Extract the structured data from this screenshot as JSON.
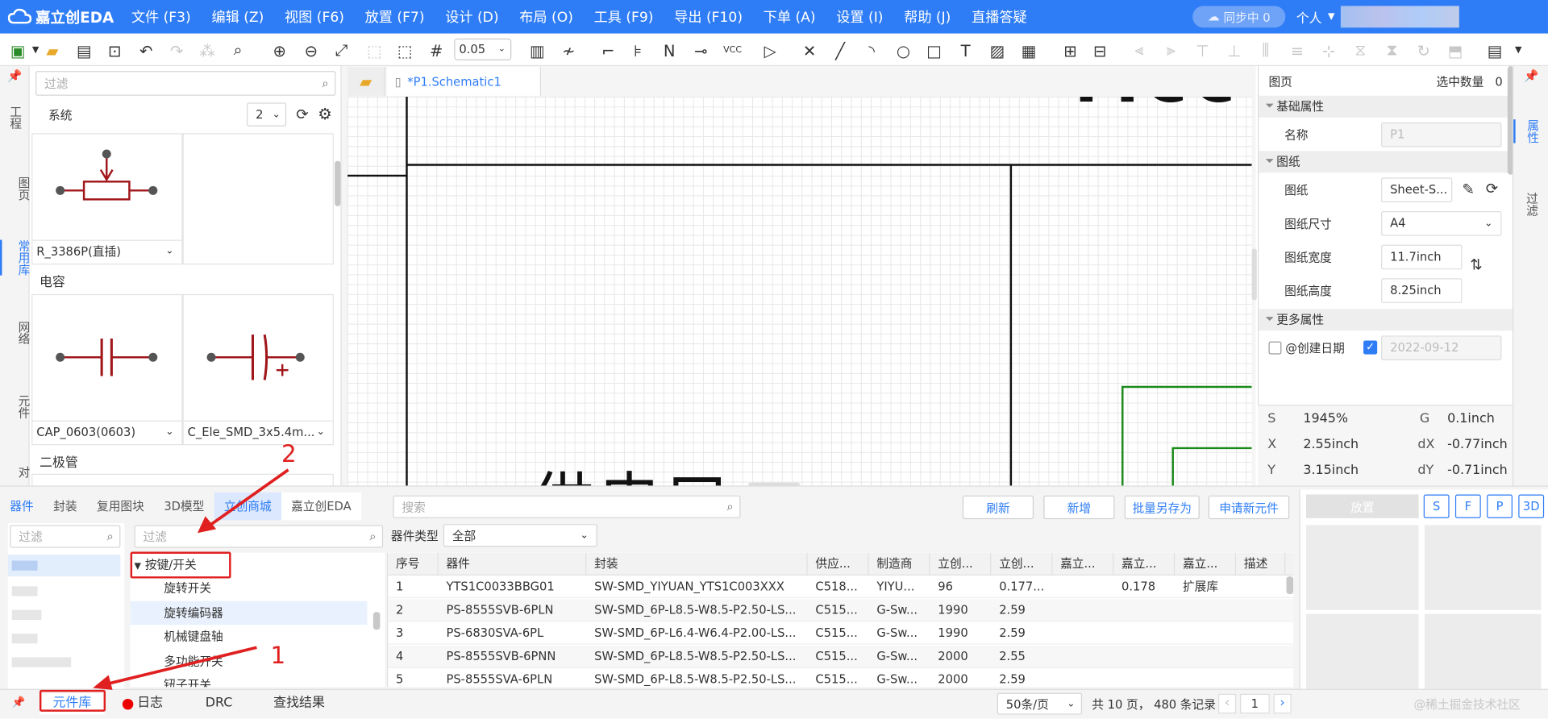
{
  "app": {
    "logo": "嘉立创EDA",
    "menu": [
      "文件 (F3)",
      "编辑 (Z)",
      "视图 (F6)",
      "放置 (F7)",
      "设计 (D)",
      "布局 (O)",
      "工具 (F9)",
      "导出 (F10)",
      "下单 (A)",
      "设置 (I)",
      "帮助 (J)",
      "直播答疑"
    ],
    "sync": "同步中 0",
    "user": "个人"
  },
  "toolbar": {
    "zoom": "0.05"
  },
  "left_tabs": [
    "工程",
    "图页",
    "常用库",
    "网络",
    "元件",
    "对"
  ],
  "library": {
    "filter_placeholder": "过滤",
    "system_label": "系统",
    "count": "2",
    "items": [
      {
        "name": "R_3386P(直插)"
      },
      {
        "name": "CAP_0603(0603)"
      },
      {
        "name": "C_Ele_SMD_3x5.4m..."
      }
    ],
    "sections": [
      "电容",
      "二极管"
    ]
  },
  "canvas": {
    "tab": "*P1.Schematic1",
    "big_text_top": "rlcc",
    "big_text_bottom": "供电口"
  },
  "properties": {
    "title": "图页",
    "selected_label": "选中数量",
    "selected_count": "0",
    "section_basic": "基础属性",
    "name_label": "名称",
    "name_value": "P1",
    "section_sheet": "图纸",
    "sheet_label": "图纸",
    "sheet_value": "Sheet-S...",
    "size_label": "图纸尺寸",
    "size_value": "A4",
    "width_label": "图纸宽度",
    "width_value": "11.7inch",
    "height_label": "图纸高度",
    "height_value": "8.25inch",
    "section_more": "更多属性",
    "created_label": "@创建日期",
    "created_value": "2022-09-12"
  },
  "right_tabs": [
    "属性",
    "过滤"
  ],
  "coords": {
    "s_label": "S",
    "s_value": "1945%",
    "g_label": "G",
    "g_value": "0.1inch",
    "x_label": "X",
    "x_value": "2.55inch",
    "dx_label": "dX",
    "dx_value": "-0.77inch",
    "y_label": "Y",
    "y_value": "3.15inch",
    "dy_label": "dY",
    "dy_value": "-0.71inch"
  },
  "bottom": {
    "tabs": [
      "器件",
      "封装",
      "复用图块",
      "3D模型",
      "立创商城",
      "嘉立创EDA"
    ],
    "search_placeholder": "搜索",
    "buttons": [
      "刷新",
      "新增",
      "批量另存为",
      "申请新元件"
    ],
    "filter_placeholder": "过滤",
    "tree_filter_placeholder": "过滤",
    "type_label": "器件类型",
    "type_value": "全部",
    "tree": [
      "按键/开关",
      "旋转开关",
      "旋转编码器",
      "机械键盘轴",
      "多功能开关",
      "钮子开关"
    ],
    "columns": [
      "序号",
      "器件",
      "封装",
      "供应...",
      "制造商",
      "立创...",
      "立创...",
      "嘉立...",
      "嘉立...",
      "嘉立...",
      "描述"
    ],
    "rows": [
      [
        "1",
        "YTS1C0033BBG01",
        "SW-SMD_YIYUAN_YTS1C003XXX",
        "C518...",
        "YIYU...",
        "96",
        "0.177...",
        "",
        "0.178",
        "扩展库",
        ""
      ],
      [
        "2",
        "PS-8555SVB-6PLN",
        "SW-SMD_6P-L8.5-W8.5-P2.50-LS...",
        "C515...",
        "G-Sw...",
        "1990",
        "2.59",
        "",
        "",
        "",
        ""
      ],
      [
        "3",
        "PS-6830SVA-6PL",
        "SW-SMD_6P-L6.4-W6.4-P2.00-LS...",
        "C515...",
        "G-Sw...",
        "1990",
        "2.59",
        "",
        "",
        "",
        ""
      ],
      [
        "4",
        "PS-8555SVB-6PNN",
        "SW-SMD_6P-L8.5-W8.5-P2.50-LS...",
        "C515...",
        "G-Sw...",
        "2000",
        "2.55",
        "",
        "",
        "",
        ""
      ],
      [
        "5",
        "PS-8555SVA-6PLN",
        "SW-SMD_6P-L8.5-W8.5-P2.50-LS...",
        "C515...",
        "G-Sw...",
        "2000",
        "2.59",
        "",
        "",
        "",
        ""
      ]
    ],
    "place_button": "放置",
    "view_buttons": [
      "S",
      "F",
      "P",
      "3D"
    ]
  },
  "statusbar": {
    "tabs": [
      "元件库",
      "日志",
      "DRC",
      "查找结果"
    ],
    "page_size": "50条/页",
    "summary": "共 10 页， 480 条记录",
    "page": "1",
    "watermark": "@稀土掘金技术社区"
  },
  "annotations": {
    "one": "1",
    "two": "2"
  },
  "colors": {
    "accent": "#2f7df6",
    "highlight": "#e02020",
    "schematic_symbol": "#a0161b",
    "wire": "#1a8a1a"
  }
}
